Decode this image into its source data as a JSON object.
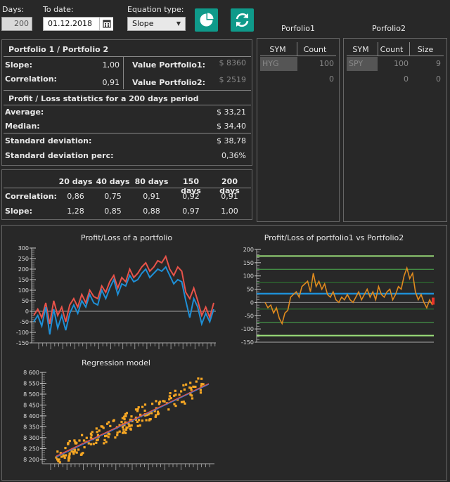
{
  "controls": {
    "days_label": "Days:",
    "days_value": "200",
    "todate_label": "To date:",
    "todate_value": "01.12.2018",
    "eqtype_label": "Equation type:",
    "eqtype_value": "Slope",
    "pie_button_icon": "pie-chart-icon",
    "refresh_button_icon": "refresh-icon"
  },
  "summary": {
    "title": "Portfolio 1 / Portfolio 2",
    "slope_label": "Slope:",
    "slope_value": "1,00",
    "correlation_label": "Correlation:",
    "correlation_value": "0,91",
    "value_p1_label": "Value Portfolio1:",
    "value_p1": "$ 8360",
    "value_p2_label": "Value Portfolio2:",
    "value_p2": "$ 2519",
    "pl_title": "Profit / Loss statistics for a 200 days period",
    "average_label": "Average:",
    "average_value": "$ 33,21",
    "median_label": "Median:",
    "median_value": "$ 34,40",
    "std_label": "Standard deviation:",
    "std_value": "$ 38,78",
    "stdperc_label": "Standard deviation perc:",
    "stdperc_value": "0,36%"
  },
  "periods": {
    "headers": [
      "20 days",
      "40 days",
      "80 days",
      "150 days",
      "200 days"
    ],
    "correlation_label": "Correlation:",
    "correlation": [
      "0,86",
      "0,75",
      "0,91",
      "0,92",
      "0,91"
    ],
    "slope_label": "Slope:",
    "slope": [
      "1,28",
      "0,85",
      "0,88",
      "0,97",
      "1,00"
    ]
  },
  "portfolio1": {
    "title": "Porfolio1",
    "columns": [
      "SYM",
      "Count"
    ],
    "rows": [
      [
        "HYG",
        "100"
      ],
      [
        "",
        "0"
      ]
    ]
  },
  "portfolio2": {
    "title": "Porfolio2",
    "columns": [
      "SYM",
      "Count",
      "Size"
    ],
    "rows": [
      [
        "SPY",
        "100",
        "9"
      ],
      [
        "",
        "0",
        "0"
      ]
    ]
  },
  "charts_titles": {
    "pl": "Profit/Loss of a portfolio",
    "pl_vs": "Profit/Loss of portfolio1 vs Portfolio2",
    "regression": "Regression model"
  },
  "colors": {
    "teal": "#0f9a8a",
    "red_series": "#e8534a",
    "blue_series": "#1e8fd6",
    "orange_series": "#e08a1e",
    "green_line": "#9be07a",
    "scatter": "#f5a623",
    "fit": "#e8534a"
  },
  "chart_data": [
    {
      "type": "line",
      "title": "Profit/Loss of a portfolio",
      "ylim": [
        -150,
        300
      ],
      "yticks": [
        -150,
        -100,
        -50,
        0,
        50,
        100,
        150,
        200,
        250,
        300
      ],
      "series": [
        {
          "values": [
            -20,
            10,
            -30,
            40,
            -60,
            50,
            -20,
            20,
            -50,
            30,
            60,
            20,
            80,
            40,
            100,
            70,
            60,
            120,
            90,
            140,
            170,
            110,
            160,
            140,
            200,
            160,
            180,
            210,
            230,
            190,
            210,
            240,
            230,
            260,
            200,
            170,
            210,
            190,
            90,
            60,
            110,
            50,
            -20,
            20,
            -30,
            40
          ]
        },
        {
          "values": [
            -50,
            -20,
            -70,
            20,
            -110,
            10,
            -80,
            -20,
            -90,
            -10,
            30,
            -10,
            50,
            20,
            80,
            40,
            30,
            100,
            60,
            110,
            150,
            80,
            130,
            120,
            170,
            140,
            150,
            180,
            200,
            160,
            180,
            200,
            190,
            210,
            170,
            130,
            150,
            140,
            50,
            -30,
            60,
            20,
            -60,
            -10,
            -50,
            10
          ]
        }
      ]
    },
    {
      "type": "line",
      "title": "Profit/Loss of portfolio1 vs Portfolio2",
      "ylim": [
        -150,
        200
      ],
      "yticks": [
        -150,
        -100,
        -50,
        0,
        50,
        100,
        150,
        200
      ],
      "series": [
        {
          "values": [
            0,
            -20,
            -10,
            -40,
            -20,
            -60,
            -80,
            -40,
            -30,
            20,
            30,
            40,
            20,
            60,
            70,
            80,
            40,
            110,
            60,
            80,
            50,
            70,
            30,
            20,
            40,
            10,
            0,
            20,
            10,
            30,
            10,
            0,
            20,
            40,
            10,
            30,
            50,
            20,
            40,
            10,
            60,
            30,
            20,
            40,
            50,
            10,
            30,
            60,
            50,
            100,
            130,
            90,
            110,
            40,
            10,
            30,
            0,
            -20,
            10,
            -10
          ]
        }
      ]
    },
    {
      "type": "scatter",
      "title": "Regression model",
      "ylim": [
        8180,
        8600
      ],
      "yticks": [
        8200,
        8250,
        8300,
        8350,
        8400,
        8450,
        8500,
        8550,
        8600
      ]
    }
  ]
}
